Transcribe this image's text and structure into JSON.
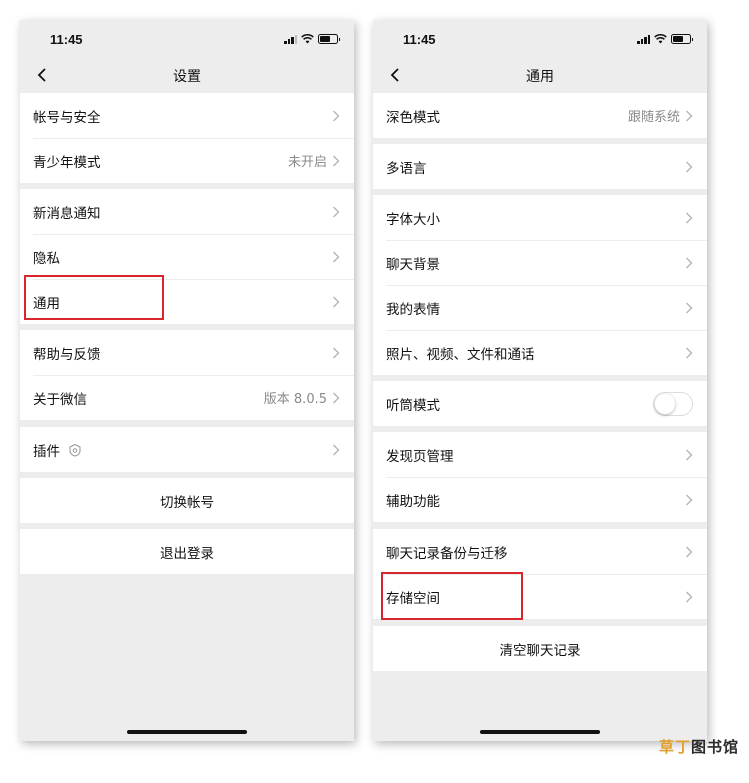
{
  "left_screen": {
    "time": "11:45",
    "title": "设置",
    "groups": [
      [
        {
          "label": "帐号与安全",
          "value": ""
        },
        {
          "label": "青少年模式",
          "value": "未开启"
        }
      ],
      [
        {
          "label": "新消息通知",
          "value": ""
        },
        {
          "label": "隐私",
          "value": ""
        },
        {
          "label": "通用",
          "value": ""
        }
      ],
      [
        {
          "label": "帮助与反馈",
          "value": ""
        },
        {
          "label": "关于微信",
          "value": "版本 8.0.5"
        }
      ],
      [
        {
          "label": "插件",
          "value": ""
        }
      ]
    ],
    "switch_account": "切换帐号",
    "logout": "退出登录"
  },
  "right_screen": {
    "time": "11:45",
    "title": "通用",
    "groups": [
      [
        {
          "label": "深色模式",
          "value": "跟随系统"
        }
      ],
      [
        {
          "label": "多语言",
          "value": ""
        }
      ],
      [
        {
          "label": "字体大小",
          "value": ""
        },
        {
          "label": "聊天背景",
          "value": ""
        },
        {
          "label": "我的表情",
          "value": ""
        },
        {
          "label": "照片、视频、文件和通话",
          "value": ""
        }
      ],
      [
        {
          "label": "听筒模式",
          "toggle_on": false
        }
      ],
      [
        {
          "label": "发现页管理",
          "value": ""
        },
        {
          "label": "辅助功能",
          "value": ""
        }
      ],
      [
        {
          "label": "聊天记录备份与迁移",
          "value": ""
        },
        {
          "label": "存储空间",
          "value": ""
        }
      ]
    ],
    "clear_chat": "清空聊天记录"
  },
  "watermark": {
    "part1": "草丁",
    "part2": "图书馆"
  },
  "colors": {
    "highlight": "#d9262c",
    "background": "#ededed",
    "accent_watermark": "#e0a030"
  }
}
